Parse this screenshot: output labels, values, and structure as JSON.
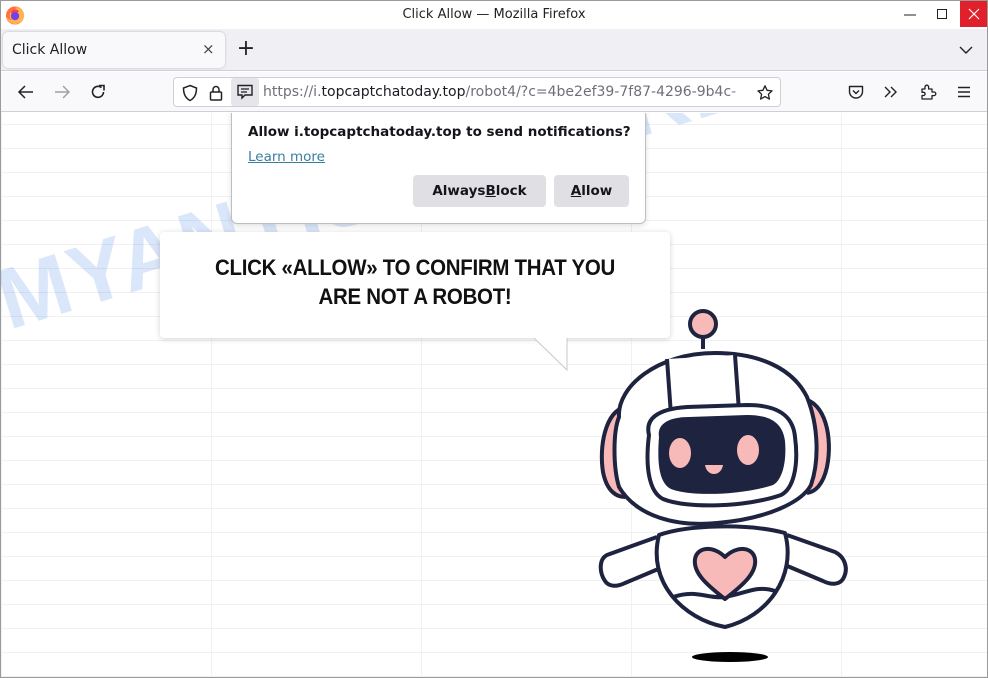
{
  "window": {
    "title": "Click Allow — Mozilla Firefox",
    "close_color": "#e0202a"
  },
  "tabs": [
    {
      "label": "Click Allow",
      "active": true
    }
  ],
  "navbar": {
    "url_scheme": "https://i.",
    "url_host": "topcaptchatoday.top",
    "url_path": "/robot4/?c=4be2ef39-7f87-4296-9b4c-"
  },
  "permission_popup": {
    "question": "Allow i.topcaptchatoday.top to send notifications?",
    "learn_more": "Learn more",
    "block_pre": "Always ",
    "block_access": "B",
    "block_post": "lock",
    "allow_access": "A",
    "allow_post": "llow",
    "link_color": "#3a7f9c"
  },
  "page": {
    "message_line1": "CLICK «ALLOW» TO CONFIRM THAT YOU",
    "message_line2": "ARE NOT A ROBOT!",
    "watermark": "MYANTISPYWARE.COM",
    "robot_accent": "#f8b9b9",
    "robot_outline": "#1e2340"
  }
}
